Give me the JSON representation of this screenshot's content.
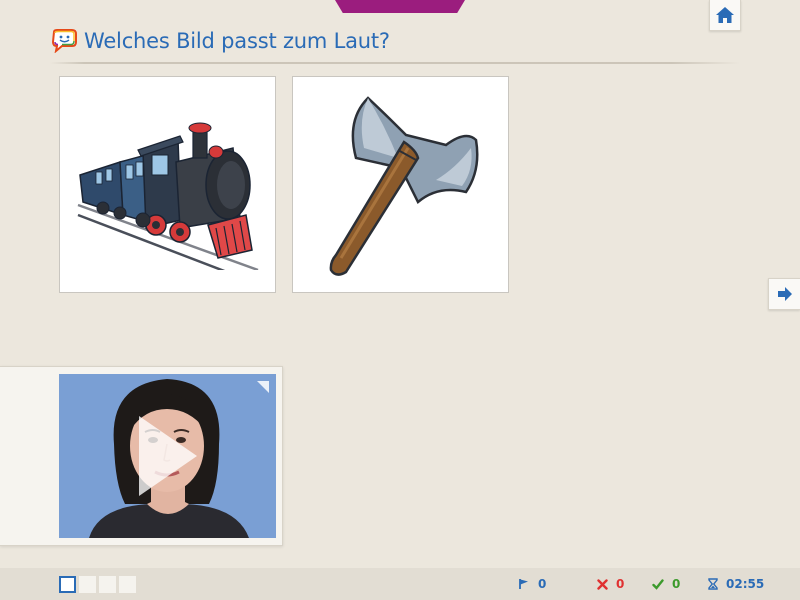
{
  "header": {
    "question": "Welches Bild passt zum Laut?",
    "icon": "speech-bubble-icon"
  },
  "cards": [
    {
      "name": "train-picture",
      "icon": "steam-locomotive-illustration"
    },
    {
      "name": "axe-picture",
      "icon": "axe-illustration"
    }
  ],
  "video": {
    "icon": "play-icon",
    "expand_icon": "expand-icon"
  },
  "navigation": {
    "home_icon": "home-icon",
    "next_icon": "arrow-right-icon"
  },
  "progress": {
    "total": 4,
    "current": 1
  },
  "status": {
    "flags": "0",
    "wrong": "0",
    "correct": "0",
    "time": "02:55"
  },
  "colors": {
    "accent": "#2a6bb6",
    "top_tab": "#9b1d7e",
    "wrong": "#e03131",
    "correct": "#3c9a2c"
  }
}
